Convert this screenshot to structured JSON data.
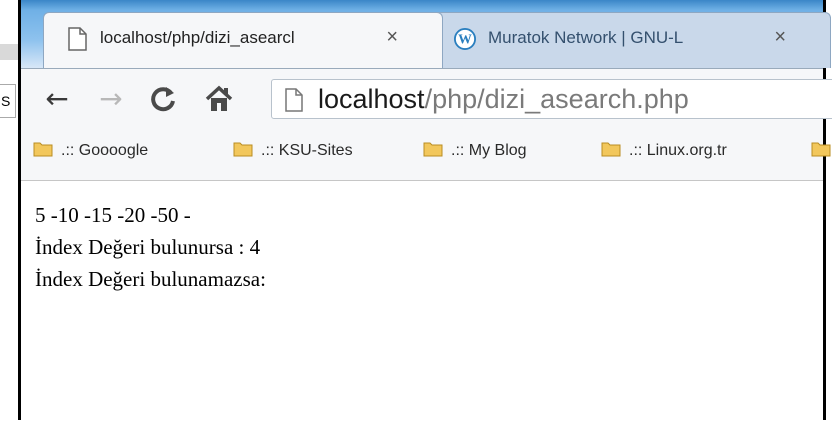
{
  "background": {
    "input_fragment": "S"
  },
  "tabs": [
    {
      "title": "localhost/php/dizi_asearcl",
      "close": "×",
      "active": true
    },
    {
      "title": "Muratok Network | GNU-L",
      "close": "×",
      "active": false
    }
  ],
  "toolbar": {
    "back_glyph": "←",
    "forward_glyph": "→",
    "reload_glyph": "C",
    "home_glyph": "🏠",
    "url_host": "localhost",
    "url_path": "/php/dizi_asearch.php"
  },
  "bookmarks": [
    {
      "label": ".:: Goooogle"
    },
    {
      "label": ".:: KSU-Sites"
    },
    {
      "label": ".:: My Blog"
    },
    {
      "label": ".:: Linux.org.tr"
    }
  ],
  "content": {
    "line1": "5 -10 -15 -20 -50 -",
    "line2": "İndex Değeri bulunursa : 4",
    "line3": "İndex Değeri bulunamazsa:"
  },
  "colors": {
    "folder": "#f2c75c",
    "titlebar": "#5aa3e0",
    "wordpress": "#2a7fbf"
  }
}
